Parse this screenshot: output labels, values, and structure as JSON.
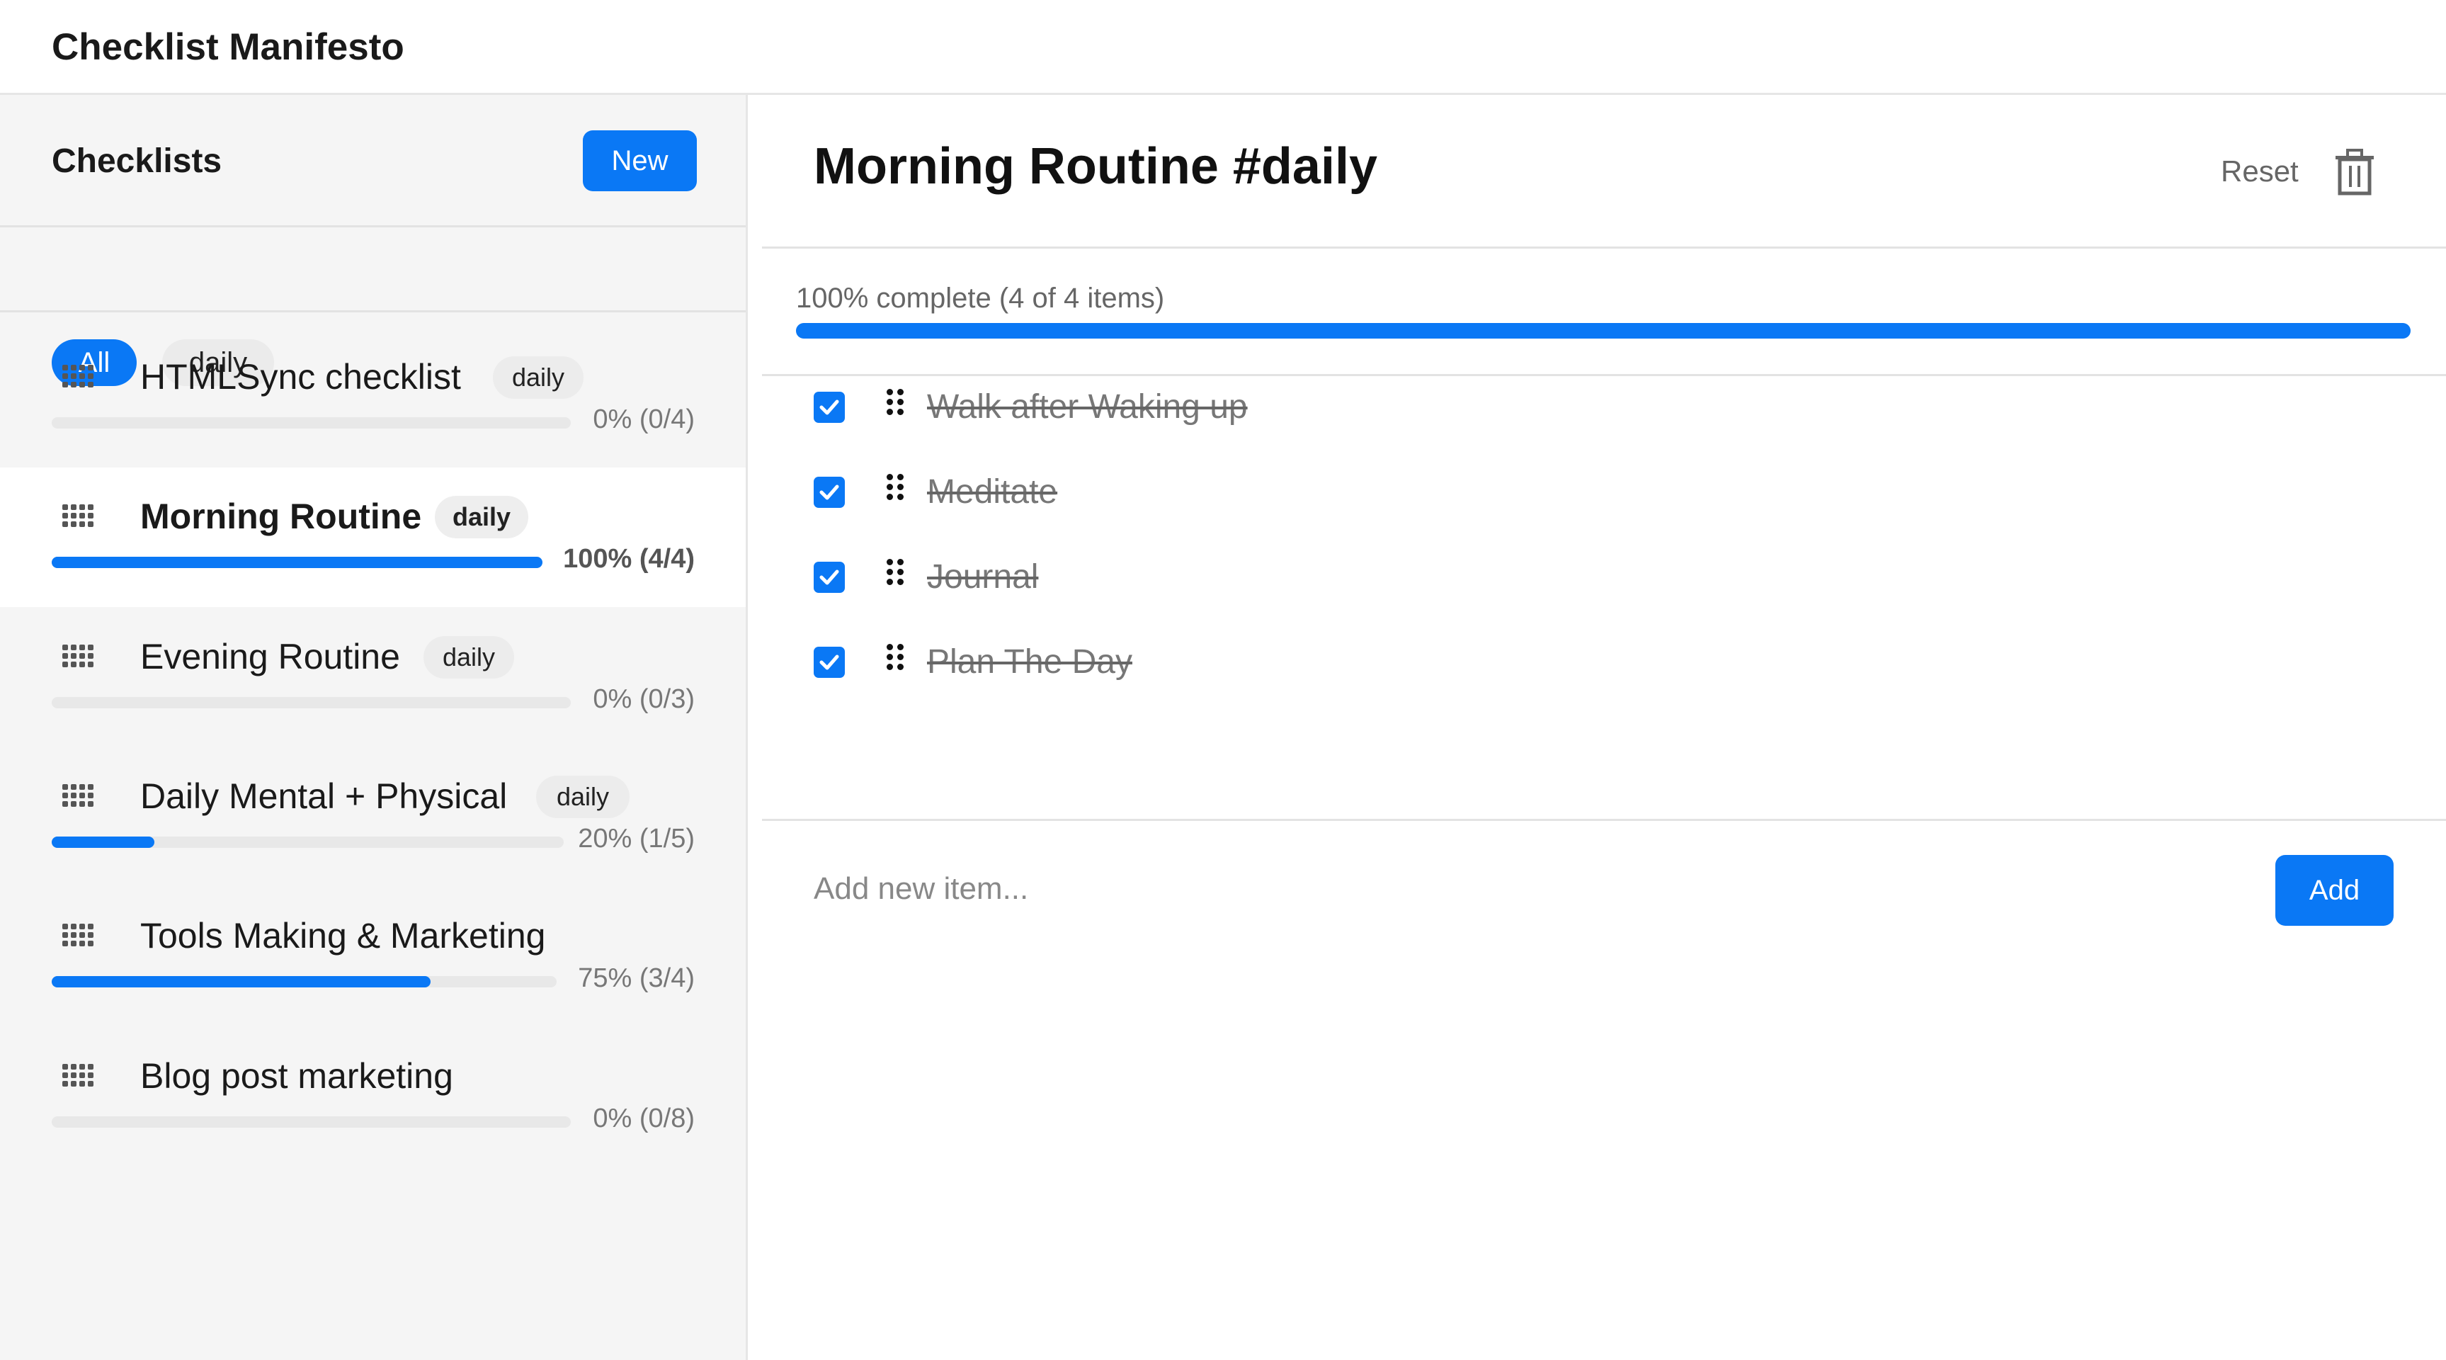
{
  "header": {
    "title": "Checklist Manifesto"
  },
  "sidebar": {
    "title": "Checklists",
    "new_label": "New",
    "filters": [
      {
        "label": "All",
        "active": true
      },
      {
        "label": "daily",
        "active": false
      }
    ],
    "items": [
      {
        "name": "HTMLSync checklist",
        "tag": "daily",
        "progress_text": "0% (0/4)",
        "progress": 0,
        "selected": false
      },
      {
        "name": "Morning Routine",
        "tag": "daily",
        "progress_text": "100% (4/4)",
        "progress": 1.0,
        "selected": true
      },
      {
        "name": "Evening Routine",
        "tag": "daily",
        "progress_text": "0% (0/3)",
        "progress": 0,
        "selected": false
      },
      {
        "name": "Daily Mental + Physical",
        "tag": "daily",
        "progress_text": "20% (1/5)",
        "progress": 0.2,
        "selected": false
      },
      {
        "name": "Tools Making & Marketing",
        "tag": "",
        "progress_text": "75% (3/4)",
        "progress": 0.75,
        "selected": false
      },
      {
        "name": "Blog post marketing",
        "tag": "",
        "progress_text": "0% (0/8)",
        "progress": 0,
        "selected": false
      }
    ]
  },
  "main": {
    "title": "Morning Routine #daily",
    "reset_label": "Reset",
    "progress_text": "100% complete (4 of 4 items)",
    "progress": 1.0,
    "items": [
      {
        "text": "Walk after Waking up",
        "checked": true
      },
      {
        "text": "Meditate",
        "checked": true
      },
      {
        "text": "Journal",
        "checked": true
      },
      {
        "text": "Plan The Day",
        "checked": true
      }
    ],
    "add_placeholder": "Add new item...",
    "add_label": "Add"
  },
  "colors": {
    "accent": "#0a78f5",
    "sidebar_bg": "#f5f5f5"
  }
}
